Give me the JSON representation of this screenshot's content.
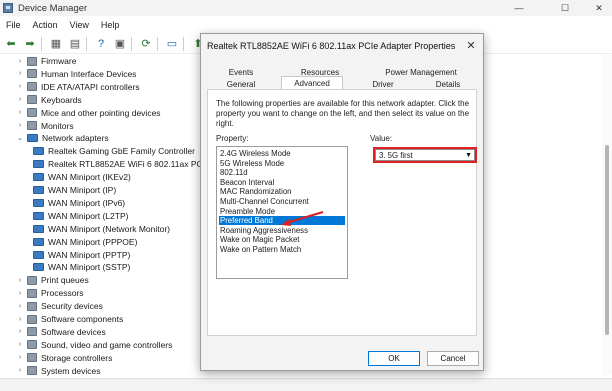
{
  "window": {
    "title": "Device Manager",
    "controls": [
      "—",
      "☐",
      "✕"
    ]
  },
  "menu": [
    "File",
    "Action",
    "View",
    "Help"
  ],
  "toolbar_icons": [
    "back-icon",
    "forward-icon",
    "properties-icon",
    "show-hidden-icon",
    "help-icon",
    "driver-icon",
    "scan-icon",
    "monitor-icon",
    "enable-device-icon",
    "uninstall-icon"
  ],
  "tree": [
    {
      "label": "Firmware",
      "expanded": false,
      "depth": 1
    },
    {
      "label": "Human Interface Devices",
      "expanded": false,
      "depth": 1
    },
    {
      "label": "IDE ATA/ATAPI controllers",
      "expanded": false,
      "depth": 1
    },
    {
      "label": "Keyboards",
      "expanded": false,
      "depth": 1
    },
    {
      "label": "Mice and other pointing devices",
      "expanded": false,
      "depth": 1
    },
    {
      "label": "Monitors",
      "expanded": false,
      "depth": 1
    },
    {
      "label": "Network adapters",
      "expanded": true,
      "depth": 1
    },
    {
      "label": "Realtek Gaming GbE Family Controller",
      "depth": 2
    },
    {
      "label": "Realtek RTL8852AE WiFi 6 802.11ax PCIe",
      "depth": 2
    },
    {
      "label": "WAN Miniport (IKEv2)",
      "depth": 2
    },
    {
      "label": "WAN Miniport (IP)",
      "depth": 2
    },
    {
      "label": "WAN Miniport (IPv6)",
      "depth": 2
    },
    {
      "label": "WAN Miniport (L2TP)",
      "depth": 2
    },
    {
      "label": "WAN Miniport (Network Monitor)",
      "depth": 2
    },
    {
      "label": "WAN Miniport (PPPOE)",
      "depth": 2
    },
    {
      "label": "WAN Miniport (PPTP)",
      "depth": 2
    },
    {
      "label": "WAN Miniport (SSTP)",
      "depth": 2
    },
    {
      "label": "Print queues",
      "expanded": false,
      "depth": 1
    },
    {
      "label": "Processors",
      "expanded": false,
      "depth": 1
    },
    {
      "label": "Security devices",
      "expanded": false,
      "depth": 1
    },
    {
      "label": "Software components",
      "expanded": false,
      "depth": 1
    },
    {
      "label": "Software devices",
      "expanded": false,
      "depth": 1
    },
    {
      "label": "Sound, video and game controllers",
      "expanded": false,
      "depth": 1
    },
    {
      "label": "Storage controllers",
      "expanded": false,
      "depth": 1
    },
    {
      "label": "System devices",
      "expanded": false,
      "depth": 1
    }
  ],
  "dialog": {
    "title": "Realtek RTL8852AE WiFi 6 802.11ax PCIe Adapter Properties",
    "close": "✕",
    "tabs_row1": [
      "Events",
      "Resources",
      "Power Management"
    ],
    "tabs_row2": [
      "General",
      "Advanced",
      "Driver",
      "Details"
    ],
    "selected_tab": "Advanced",
    "description": "The following properties are available for this network adapter. Click the property you want to change on the left, and then select its value on the right.",
    "property_label": "Property:",
    "value_label": "Value:",
    "properties": [
      "2.4G Wireless Mode",
      "5G Wireless Mode",
      "802.11d",
      "Beacon Interval",
      "MAC Randomization",
      "Multi-Channel Concurrent",
      "Preamble Mode",
      "Preferred Band",
      "Roaming Aggressiveness",
      "Wake on Magic Packet",
      "Wake on Pattern Match"
    ],
    "selected_property": "Preferred Band",
    "value": "3. 5G first",
    "ok": "OK",
    "cancel": "Cancel"
  },
  "colors": {
    "selection": "#0078d7",
    "annotation": "#e02020",
    "network_icon": "#3a7bc4"
  }
}
